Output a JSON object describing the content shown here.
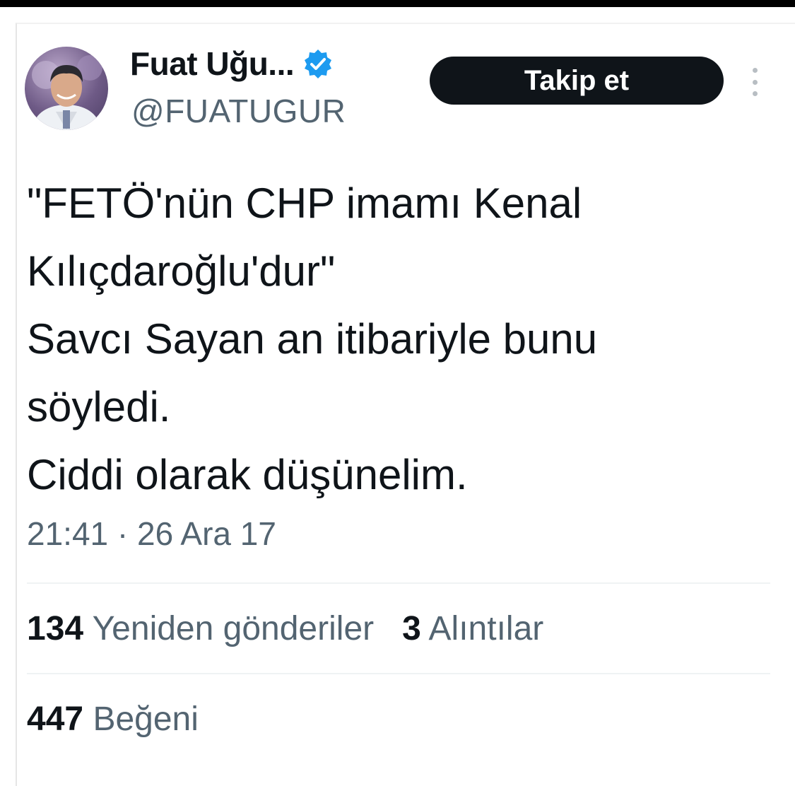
{
  "author": {
    "display_name": "Fuat Uğu...",
    "handle": "@FUATUGUR",
    "verified_icon": "verified-badge-icon",
    "avatar": "avatar"
  },
  "follow_button": {
    "label": "Takip et"
  },
  "more_icon": "more-vertical-icon",
  "tweet": {
    "lines": [
      "\"FETÖ'nün CHP imamı Kenal",
      "Kılıçdaroğlu'dur\"",
      "Savcı Sayan an itibariyle bunu",
      "söyledi.",
      "Ciddi olarak düşünelim."
    ],
    "timestamp": "21:41 · 26 Ara 17"
  },
  "stats": {
    "reposts_count": "134",
    "reposts_label": "Yeniden gönderiler",
    "quotes_count": "3",
    "quotes_label": "Alıntılar",
    "likes_count": "447",
    "likes_label": "Beğeni"
  },
  "colors": {
    "text_primary": "#0f1419",
    "text_secondary": "#536471",
    "button_bg": "#0f1419",
    "verified_blue": "#1d9bf0"
  }
}
